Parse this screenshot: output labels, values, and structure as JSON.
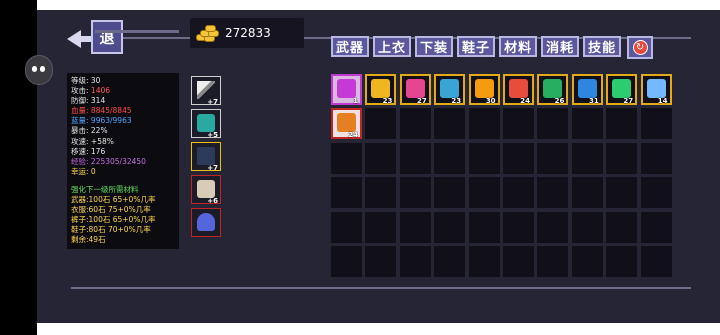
{
  "nav": {
    "back_label": "退"
  },
  "currency": {
    "gold_amount": "272833"
  },
  "tabs": [
    "武器",
    "上衣",
    "下装",
    "鞋子",
    "材料",
    "消耗",
    "技能"
  ],
  "stats": {
    "level": "等级: 30",
    "attack_label": "攻击:",
    "attack_value": "1406",
    "defense": "防御: 314",
    "hp_label": "血量:",
    "hp_value": "8845/8845",
    "mp_label": "蓝量:",
    "mp_value": "9963/9963",
    "crit": "暴击: 22%",
    "atk_speed": "攻速: +58%",
    "move_speed": "移速: 176",
    "exp_label": "经验:",
    "exp_value": "225305/32450",
    "luck": "幸运: 0"
  },
  "enhance": {
    "header": "强化下一级所需材料",
    "weapon_label": "武器:100石",
    "weapon_val": "65+0%几率",
    "clothes_label": "衣服:60石",
    "clothes_val": "75+0%几率",
    "pants_label": "裤子:100石",
    "pants_val": "65+0%几率",
    "shoes_label": "鞋子:80石",
    "shoes_val": "70+0%几率",
    "remain": "剩余:49石"
  },
  "equipment": [
    {
      "name": "weapon",
      "level": "+7"
    },
    {
      "name": "armor",
      "level": "+5"
    },
    {
      "name": "pants",
      "level": "+7"
    },
    {
      "name": "boots",
      "level": "+6"
    },
    {
      "name": "accessory",
      "level": ""
    }
  ],
  "inventory": [
    {
      "name": "spellbook",
      "count": "1",
      "color": "#c53ad4"
    },
    {
      "name": "scroll",
      "count": "23",
      "color": "#f1b521"
    },
    {
      "name": "ring",
      "count": "27",
      "color": "#e64690"
    },
    {
      "name": "bow",
      "count": "23",
      "color": "#3aa4d4"
    },
    {
      "name": "shield",
      "count": "30",
      "color": "#f39c12"
    },
    {
      "name": "fire-potion",
      "count": "24",
      "color": "#e74c3c"
    },
    {
      "name": "green-rune",
      "count": "26",
      "color": "#27ae60"
    },
    {
      "name": "blue-gem",
      "count": "31",
      "color": "#2e86de"
    },
    {
      "name": "herb",
      "count": "27",
      "color": "#2ecc71"
    },
    {
      "name": "ice-crystal",
      "count": "14",
      "color": "#74b9ff"
    },
    {
      "name": "flame-orb",
      "count": "24",
      "color": "#e67e22"
    }
  ]
}
